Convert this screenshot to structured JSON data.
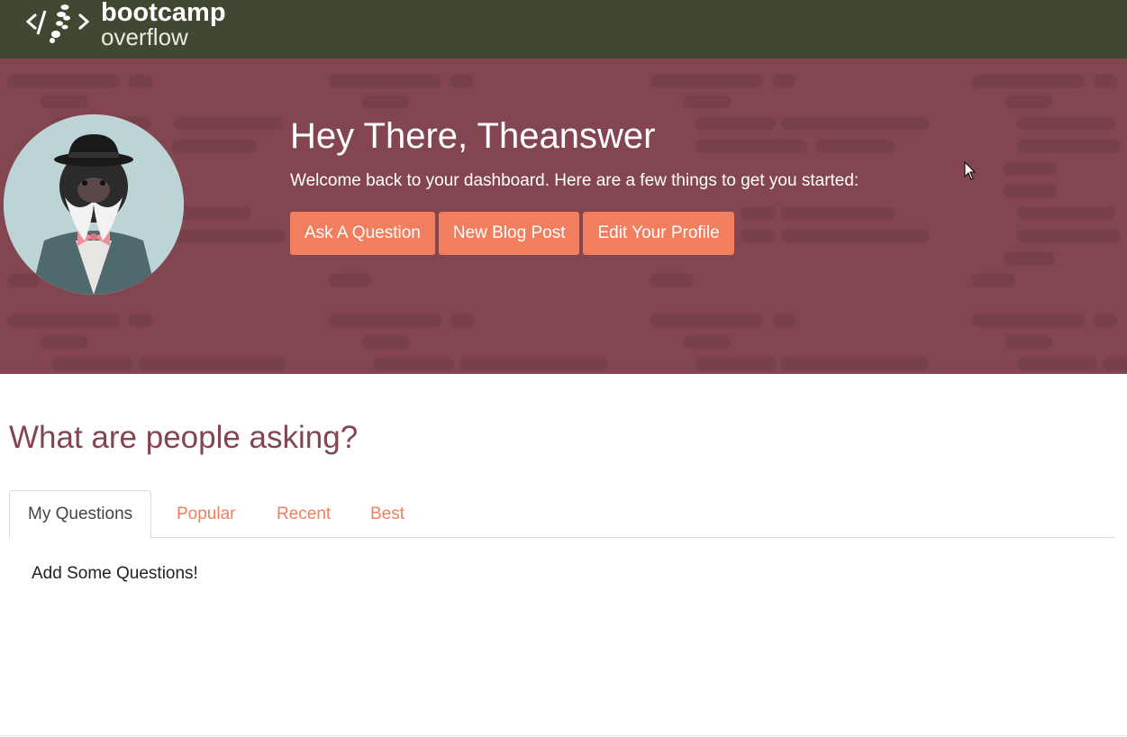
{
  "brand": {
    "line1": "bootcamp",
    "line2": "overflow",
    "bar_color": "#404832",
    "logo_icon": "code-boot-icon"
  },
  "hero": {
    "background": "#834651",
    "title": "Hey There, Theanswer",
    "subtitle": "Welcome back to your dashboard. Here are a few things to get you started:",
    "avatar_alt": "monkey-in-bowler-hat-avatar",
    "actions": [
      {
        "label": "Ask A Question"
      },
      {
        "label": "New Blog Post"
      },
      {
        "label": "Edit Your Profile"
      }
    ],
    "accent": "#f07e5f"
  },
  "main": {
    "section_title": "What are people asking?",
    "tabs": [
      {
        "label": "My Questions",
        "active": true
      },
      {
        "label": "Popular",
        "active": false
      },
      {
        "label": "Recent",
        "active": false
      },
      {
        "label": "Best",
        "active": false
      }
    ],
    "empty_message": "Add Some Questions!"
  }
}
